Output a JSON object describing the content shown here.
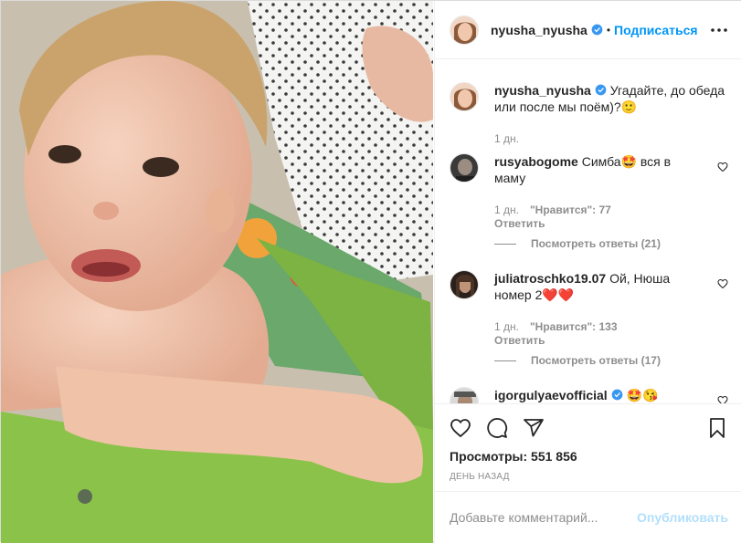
{
  "post": {
    "author": "nyusha_nyusha",
    "follow_label": "Подписаться",
    "dot": "•"
  },
  "caption": {
    "username": "nyusha_nyusha",
    "text": "Угадайте, до обеда или после мы поём)?🙂",
    "time": "1 дн."
  },
  "comments": [
    {
      "username": "rusyabogome",
      "text": "Симба🤩 вся в маму",
      "time": "1 дн.",
      "likes": "\"Нравится\": 77",
      "reply_label": "Ответить",
      "view_replies": "Посмотреть ответы (21)"
    },
    {
      "username": "juliatroschko19.07",
      "text": "Ой, Нюша номер 2❤️❤️",
      "time": "1 дн.",
      "likes": "\"Нравится\": 133",
      "reply_label": "Ответить",
      "view_replies": "Посмотреть ответы (17)"
    },
    {
      "username": "igorgulyaevofficial",
      "text": "🤩😘"
    }
  ],
  "stats": {
    "views": "Просмотры: 551 856",
    "posted": "День назад"
  },
  "comment_box": {
    "placeholder": "Добавьте комментарий...",
    "publish_label": "Опубликовать"
  },
  "colors": {
    "accent": "#0095f6",
    "publish_disabled": "#b2dffc",
    "verified": "#3897f0"
  },
  "icons": [
    "verified-badge-icon",
    "more-options-icon",
    "heart-icon",
    "comment-icon",
    "share-icon",
    "bookmark-icon"
  ]
}
